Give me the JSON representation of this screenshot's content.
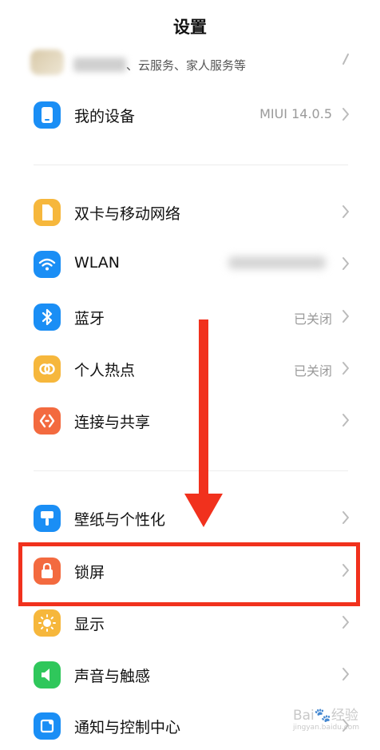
{
  "header": {
    "title": "设置"
  },
  "account": {
    "subtitle": "、云服务、家人服务等"
  },
  "items": [
    {
      "id": "my-device",
      "label": "我的设备",
      "value": "MIUI 14.0.5",
      "icon": "phone-icon",
      "color": "#1a8ef5"
    },
    {
      "id": "sim-network",
      "label": "双卡与移动网络",
      "value": "",
      "icon": "sim-card-icon",
      "color": "#f6b73c"
    },
    {
      "id": "wlan",
      "label": "WLAN",
      "value": "",
      "icon": "wifi-icon",
      "color": "#1a8ef5"
    },
    {
      "id": "bluetooth",
      "label": "蓝牙",
      "value": "已关闭",
      "icon": "bluetooth-icon",
      "color": "#1a8ef5"
    },
    {
      "id": "hotspot",
      "label": "个人热点",
      "value": "已关闭",
      "icon": "hotspot-icon",
      "color": "#f6b73c"
    },
    {
      "id": "connection-share",
      "label": "连接与共享",
      "value": "",
      "icon": "share-icon",
      "color": "#f36a3f"
    },
    {
      "id": "wallpaper",
      "label": "壁纸与个性化",
      "value": "",
      "icon": "wallpaper-icon",
      "color": "#1a8ef5"
    },
    {
      "id": "lock-screen",
      "label": "锁屏",
      "value": "",
      "icon": "lock-icon",
      "color": "#f36a3f"
    },
    {
      "id": "display",
      "label": "显示",
      "value": "",
      "icon": "sun-icon",
      "color": "#f6b73c"
    },
    {
      "id": "sound",
      "label": "声音与触感",
      "value": "",
      "icon": "speaker-icon",
      "color": "#2fc75b"
    },
    {
      "id": "notification",
      "label": "通知与控制中心",
      "value": "",
      "icon": "notification-icon",
      "color": "#1a8ef5"
    }
  ],
  "annotation": {
    "highlight_color": "#f1311d"
  },
  "watermark": {
    "brand": "Bai🐾经验",
    "url": "jingyan.baidu.com"
  }
}
